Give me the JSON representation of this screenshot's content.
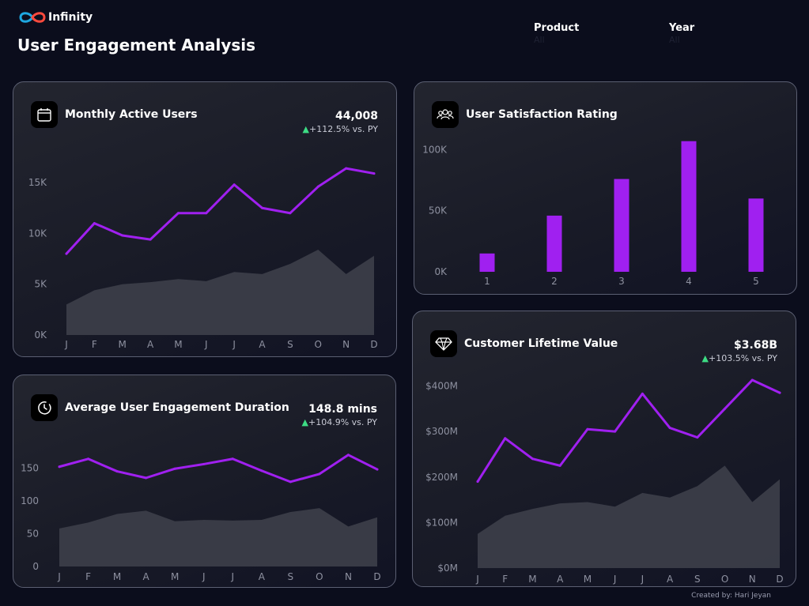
{
  "app": {
    "logo_text": "Infinity",
    "page_title": "User Engagement Analysis",
    "credit": "Created by: Hari Jeyan"
  },
  "filters": {
    "product": {
      "label": "Product",
      "value": "All"
    },
    "year": {
      "label": "Year",
      "value": "All"
    }
  },
  "colors": {
    "accent": "#a020f0",
    "area": "#3b3d48",
    "positive": "#3ddc84"
  },
  "cards": {
    "mau": {
      "title": "Monthly Active Users",
      "icon": "calendar-icon",
      "value": "44,008",
      "delta": "+112.5% vs. PY"
    },
    "satisfaction": {
      "title": "User Satisfaction Rating",
      "icon": "users-group-icon"
    },
    "duration": {
      "title": "Average User Engagement Duration",
      "icon": "clock-icon",
      "value": "148.8 mins",
      "delta": "+104.9% vs. PY"
    },
    "clv": {
      "title": "Customer Lifetime Value",
      "icon": "diamond-icon",
      "value": "$3.68B",
      "delta": "+103.5% vs. PY"
    }
  },
  "chart_data": [
    {
      "id": "mau",
      "type": "line",
      "categories": [
        "J",
        "F",
        "M",
        "A",
        "M",
        "J",
        "J",
        "A",
        "S",
        "O",
        "N",
        "D"
      ],
      "series": [
        {
          "values": [
            8000,
            11000,
            9800,
            9400,
            12000,
            12000,
            14800,
            12500,
            12000,
            14600,
            16400,
            15900
          ]
        },
        {
          "type": "area",
          "values": [
            3000,
            4400,
            5000,
            5200,
            5500,
            5300,
            6200,
            6000,
            7000,
            8400,
            6000,
            7800
          ]
        }
      ],
      "yticks": [
        0,
        5000,
        10000,
        15000
      ],
      "yticklabels": [
        "0K",
        "5K",
        "10K",
        "15K"
      ],
      "ylim": [
        0,
        17500
      ]
    },
    {
      "id": "satisfaction",
      "type": "bar",
      "categories": [
        "1",
        "2",
        "3",
        "4",
        "5"
      ],
      "values": [
        15000,
        46000,
        76000,
        107000,
        60000
      ],
      "yticks": [
        0,
        50000,
        100000
      ],
      "yticklabels": [
        "0K",
        "50K",
        "100K"
      ],
      "ylim": [
        0,
        110000
      ]
    },
    {
      "id": "duration",
      "type": "line",
      "categories": [
        "J",
        "F",
        "M",
        "A",
        "M",
        "J",
        "J",
        "A",
        "S",
        "O",
        "N",
        "D"
      ],
      "series": [
        {
          "values": [
            152,
            164,
            145,
            135,
            149,
            156,
            164,
            146,
            129,
            141,
            170,
            148
          ]
        },
        {
          "type": "area",
          "values": [
            58,
            67,
            80,
            85,
            69,
            71,
            70,
            71,
            83,
            89,
            61,
            75
          ]
        }
      ],
      "yticks": [
        0,
        50,
        100,
        150
      ],
      "yticklabels": [
        "0",
        "50",
        "100",
        "150"
      ],
      "ylim": [
        0,
        183
      ]
    },
    {
      "id": "clv",
      "type": "line",
      "categories": [
        "J",
        "F",
        "M",
        "A",
        "M",
        "J",
        "J",
        "A",
        "S",
        "O",
        "N",
        "D"
      ],
      "series": [
        {
          "values": [
            190,
            285,
            240,
            225,
            305,
            300,
            383,
            308,
            287,
            350,
            413,
            385
          ]
        },
        {
          "type": "area",
          "values": [
            75,
            115,
            130,
            142,
            145,
            135,
            165,
            155,
            180,
            225,
            145,
            195
          ]
        }
      ],
      "yticks": [
        0,
        100,
        200,
        300,
        400
      ],
      "yticklabels": [
        "$0M",
        "$100M",
        "$200M",
        "$300M",
        "$400M"
      ],
      "ylim": [
        0,
        420
      ]
    }
  ]
}
